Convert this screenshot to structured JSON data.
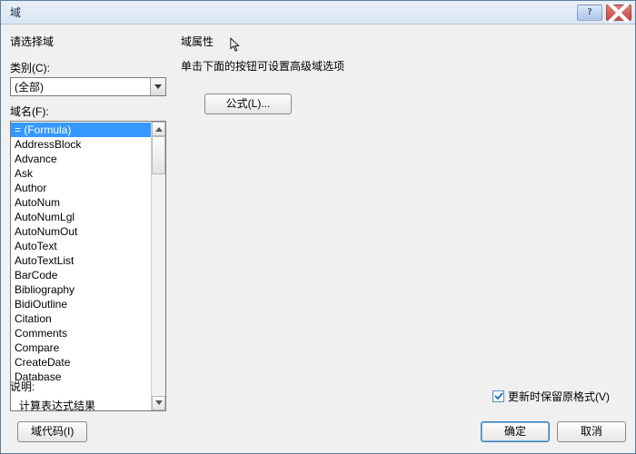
{
  "window": {
    "title": "域"
  },
  "left": {
    "select_field": "请选择域",
    "category_label": "类别(C):",
    "category_value": "(全部)",
    "fieldname_label": "域名(F):",
    "items": [
      "= (Formula)",
      "AddressBlock",
      "Advance",
      "Ask",
      "Author",
      "AutoNum",
      "AutoNumLgl",
      "AutoNumOut",
      "AutoText",
      "AutoTextList",
      "BarCode",
      "Bibliography",
      "BidiOutline",
      "Citation",
      "Comments",
      "Compare",
      "CreateDate",
      "Database"
    ],
    "desc_label": "说明:",
    "desc_text": "计算表达式结果",
    "field_codes_btn": "域代码(I)"
  },
  "right": {
    "props_label": "域属性",
    "props_note": "单击下面的按钮可设置高级域选项",
    "formula_btn": "公式(L)...",
    "preserve_label": "更新时保留原格式(V)"
  },
  "footer": {
    "ok": "确定",
    "cancel": "取消"
  }
}
